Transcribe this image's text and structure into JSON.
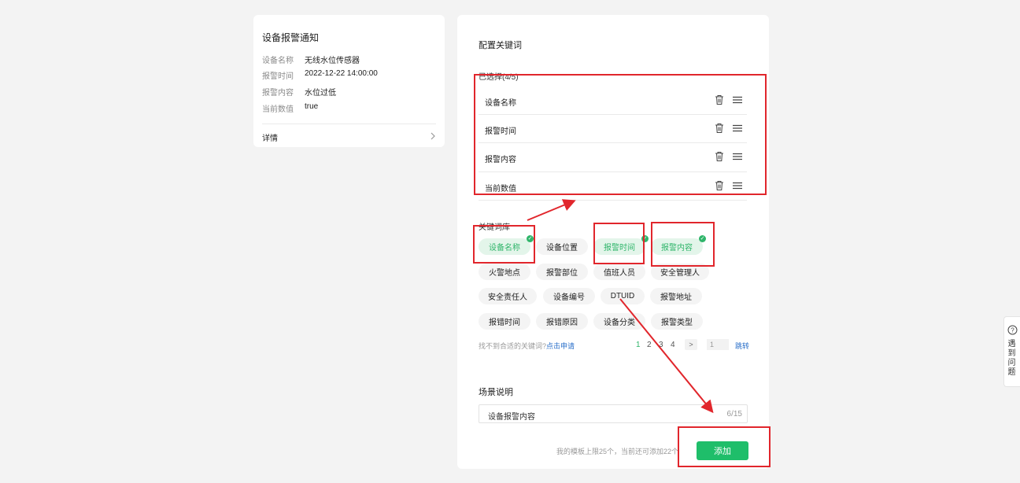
{
  "left_card": {
    "title": "设备报警通知",
    "fields": [
      {
        "label": "设备名称",
        "value": "无线水位传感器"
      },
      {
        "label": "报警时间",
        "value": "2022-12-22 14:00:00"
      },
      {
        "label": "报警内容",
        "value": "水位过低"
      },
      {
        "label": "当前数值",
        "value": "true"
      }
    ],
    "details_label": "详情"
  },
  "right_card": {
    "title": "配置关键词",
    "selected_label": "已选择(4/5)",
    "selected_items": [
      "设备名称",
      "报警时间",
      "报警内容",
      "当前数值"
    ],
    "library_label": "关键词库",
    "chips": [
      {
        "label": "设备名称",
        "selected": true
      },
      {
        "label": "设备位置",
        "selected": false
      },
      {
        "label": "报警时间",
        "selected": true
      },
      {
        "label": "报警内容",
        "selected": true
      },
      {
        "label": "火警地点",
        "selected": false
      },
      {
        "label": "报警部位",
        "selected": false
      },
      {
        "label": "值班人员",
        "selected": false
      },
      {
        "label": "安全管理人",
        "selected": false
      },
      {
        "label": "安全责任人",
        "selected": false
      },
      {
        "label": "设备编号",
        "selected": false
      },
      {
        "label": "DTUID",
        "selected": false
      },
      {
        "label": "报警地址",
        "selected": false
      },
      {
        "label": "报错时间",
        "selected": false
      },
      {
        "label": "报错原因",
        "selected": false
      },
      {
        "label": "设备分类",
        "selected": false
      },
      {
        "label": "报警类型",
        "selected": false
      }
    ],
    "not_found_text": "找不到合适的关键词?",
    "apply_link": "点击申请",
    "pagination": {
      "pages": [
        "1",
        "2",
        "3",
        "4"
      ],
      "current": "1",
      "next": ">",
      "jump_value": "1",
      "jump_label": "跳转"
    },
    "scene_label": "场景说明",
    "scene_value": "设备报警内容",
    "scene_counter": "6/15",
    "limit_text": "我的模板上限25个，当前还可添加22个",
    "add_button": "添加"
  },
  "help_widget": {
    "text": "遇到问题"
  },
  "colors": {
    "accent_green": "#1fbe6a",
    "annotation_red": "#e1262c"
  }
}
